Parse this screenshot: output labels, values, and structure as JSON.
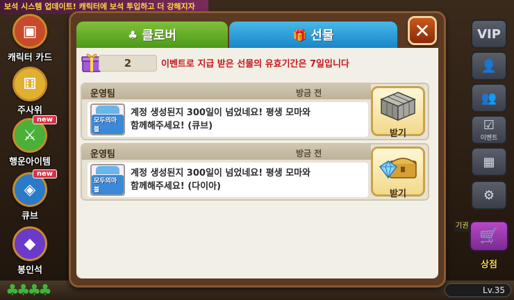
{
  "background": {
    "notice_banner": "보석 시스템 업데이트! 캐릭터에 보석 투입하고 더 강해지자",
    "left_menu": [
      {
        "label": "캐릭터 카드",
        "icon": "character-card-icon",
        "new": ""
      },
      {
        "label": "주사위",
        "icon": "dice-icon",
        "new": ""
      },
      {
        "label": "행운아이템",
        "icon": "sword-icon",
        "new": "new"
      },
      {
        "label": "큐브",
        "icon": "cube-icon",
        "new": "new"
      },
      {
        "label": "봉인석",
        "icon": "gem-icon",
        "new": ""
      }
    ],
    "right_menu": {
      "vip_label": "VIP",
      "event_label": "이벤트",
      "shop_label": "상점",
      "ticket_tag": "기권"
    },
    "level": "Lv.35",
    "colors": {
      "clover": "#3fb63a",
      "shop": "#b848c8"
    }
  },
  "dialog": {
    "tabs": [
      {
        "label": "클로버",
        "icon": "clover-icon",
        "active": false
      },
      {
        "label": "선물",
        "icon": "gift-icon",
        "active": true
      }
    ],
    "close_label": "✕",
    "gift_count": "2",
    "notice": "이벤트로 지급 받은 선물의 유효기간은 7일입니다",
    "notice_color": "#c8161a",
    "gifts": [
      {
        "sender": "운영팀",
        "time": "방금 전",
        "logo_text": "모두의마블",
        "message_line1": "계정 생성된지 300일이 넘었네요! 평생 모마와",
        "message_line2": "함께해주세요! (큐브)",
        "item_icon": "cube-item-icon",
        "button_label": "받기"
      },
      {
        "sender": "운영팀",
        "time": "방금 전",
        "logo_text": "모두의마블",
        "message_line1": "계정 생성된지 300일이 넘었네요! 평생 모마와",
        "message_line2": "함께해주세요! (다이아)",
        "item_icon": "diamond-chest-icon",
        "button_label": "받기"
      }
    ]
  }
}
